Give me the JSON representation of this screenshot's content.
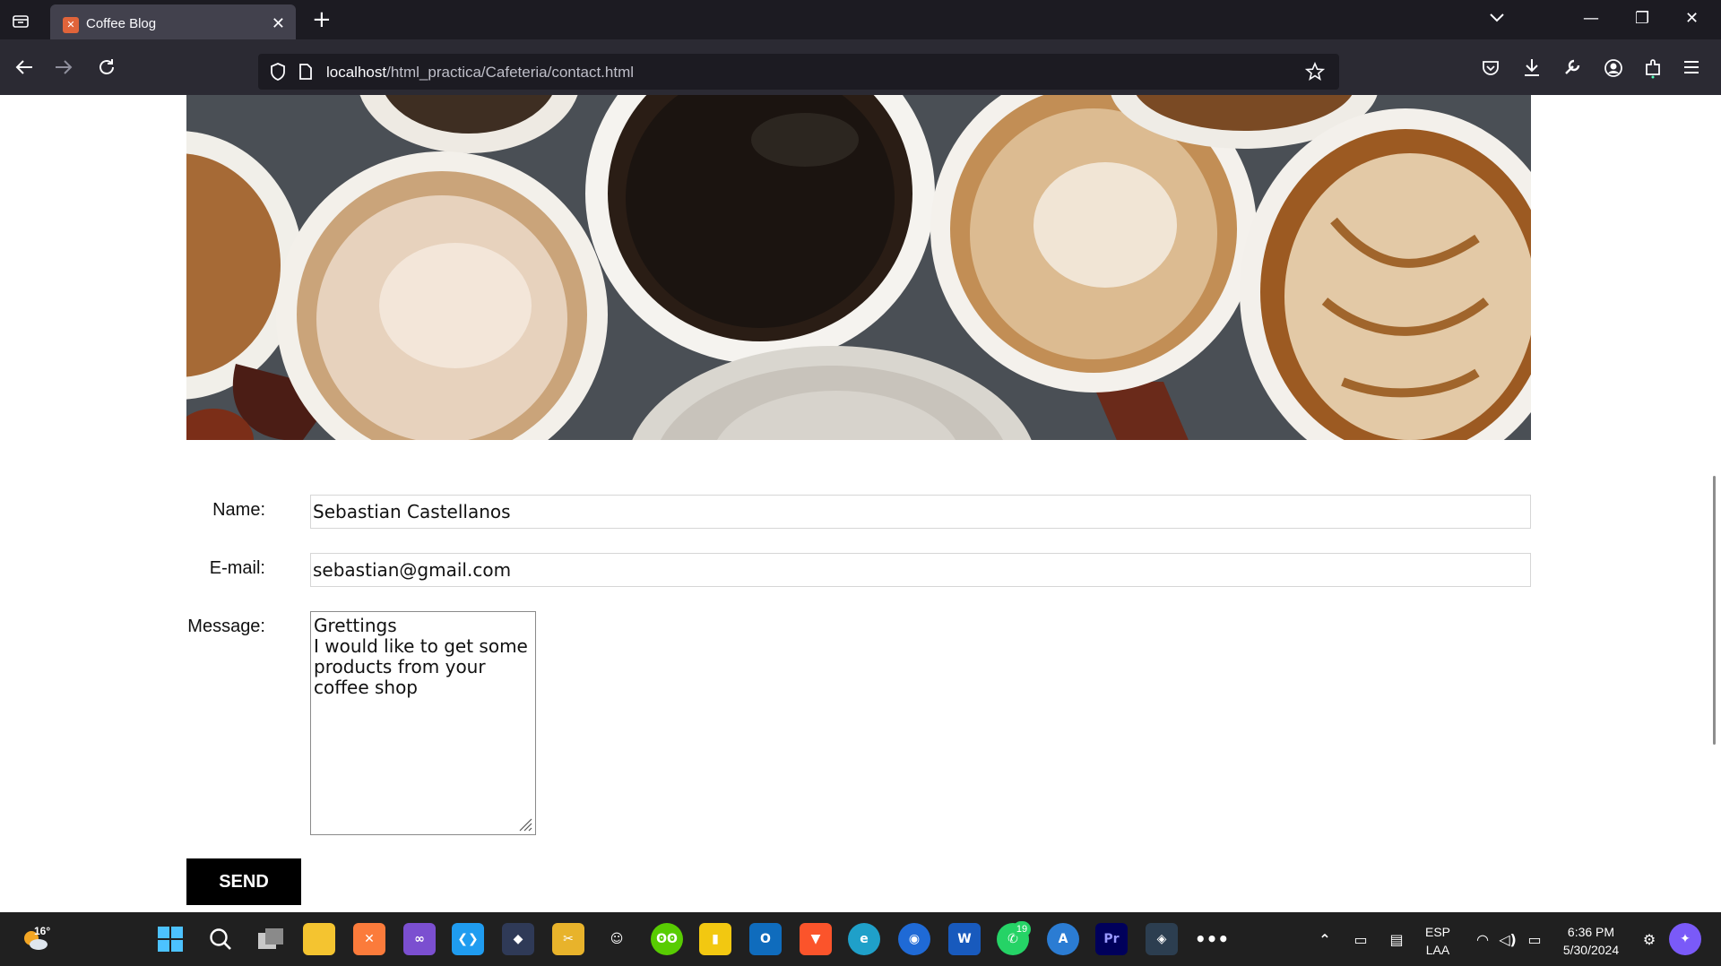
{
  "browser": {
    "tab_title": "Coffee Blog",
    "url_host": "localhost",
    "url_path": "/html_practica/Cafeteria/contact.html"
  },
  "form": {
    "name_label": "Name:",
    "name_value": "Sebastian Castellanos",
    "email_label": "E-mail:",
    "email_value": "sebastian@gmail.com",
    "message_label": "Message:",
    "message_value": "Grettings\nI would like to get some products from your coffee shop",
    "send_label": "SEND"
  },
  "taskbar": {
    "weather_temp": "16°",
    "language": "ESP",
    "keyboard": "LAA",
    "time": "6:36 PM",
    "date": "5/30/2024",
    "whatsapp_badge": "19"
  },
  "colors": {
    "page_bg": "#ffffff",
    "button_bg": "#000000",
    "browser_chrome": "#2b2a33"
  }
}
